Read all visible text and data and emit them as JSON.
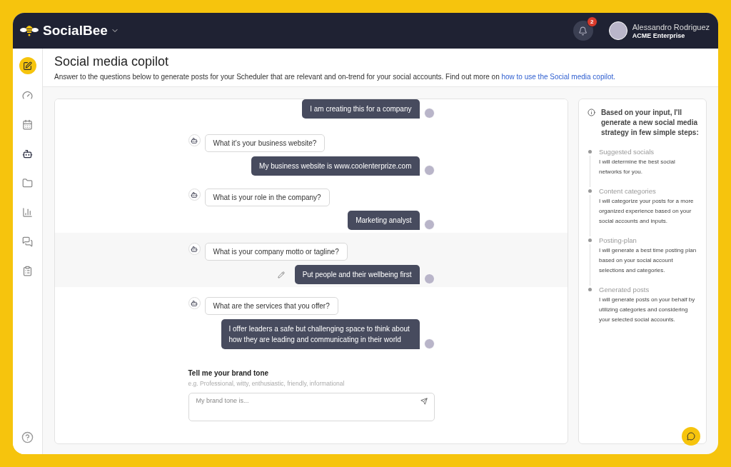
{
  "header": {
    "brand": "SocialBee",
    "notifications": {
      "count": "2"
    },
    "user": {
      "name": "Alessandro Rodriguez",
      "company": "ACME Enterprise"
    }
  },
  "sidebar": {
    "items": [
      {
        "kind": "dashboard",
        "selected": false
      },
      {
        "kind": "calendar",
        "selected": false
      },
      {
        "kind": "copilot",
        "selected": true
      },
      {
        "kind": "folder",
        "selected": false
      },
      {
        "kind": "analytics",
        "selected": false
      },
      {
        "kind": "chat",
        "selected": false
      },
      {
        "kind": "list",
        "selected": false
      }
    ]
  },
  "page": {
    "title": "Social media copilot",
    "description": "Answer to the questions below to generate posts for your Scheduler that are relevant and on-trend for your social accounts. Find out more on",
    "link": "how to use the Social media copilot."
  },
  "chat": {
    "exchanges": [
      {
        "answer": "I am creating this for a company",
        "selected": false
      },
      {
        "question": "What it’s your business website?",
        "answer": "My business website is www.coolenterprize.com",
        "selected": false
      },
      {
        "question": "What is your role in the company?",
        "answer": "Marketing analyst",
        "selected": false
      },
      {
        "question": "What is your company motto or tagline?",
        "answer": "Put people and their wellbeing first",
        "selected": true
      },
      {
        "question": "What are the services that you offer?",
        "answer": "I offer leaders a safe but challenging space to think about how they are leading and communicating in their world",
        "selected": false
      }
    ],
    "prompt": {
      "title": "Tell me your brand tone",
      "hint": "e.g. Professional, witty, enthusiastic, friendly, informational",
      "placeholder": "My brand tone is..."
    }
  },
  "info_panel": {
    "intro": "Based on your input, I'll generate a new social media strategy in few simple steps:",
    "steps": [
      {
        "title": "Suggested socials",
        "text": "I will determine the best social networks for you."
      },
      {
        "title": "Content categories",
        "text": "I will categorize your posts for a more organized experience based on your social accounts and inputs."
      },
      {
        "title": "Posting-plan",
        "text": "I will generate a best time posting plan based on your social account selections and categories."
      },
      {
        "title": "Generated posts",
        "text": "I will generate posts on your behalf by utilizing categories and considering your selected social accounts."
      }
    ]
  }
}
